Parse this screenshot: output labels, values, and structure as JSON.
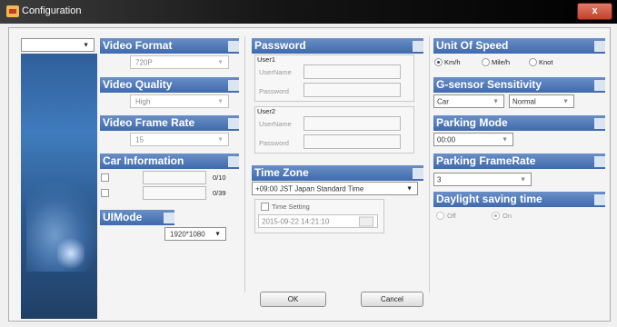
{
  "window": {
    "title": "Configuration",
    "close_glyph": "x"
  },
  "sidebar": {
    "dropdown_value": ""
  },
  "video_format": {
    "title": "Video Format",
    "value": "720P"
  },
  "video_quality": {
    "title": "Video Quality",
    "value": "High"
  },
  "video_frame_rate": {
    "title": "Video Frame Rate",
    "value": "15"
  },
  "car_information": {
    "title": "Car Information",
    "rows": [
      {
        "value": "",
        "counter": "0/10",
        "checked": false
      },
      {
        "value": "",
        "counter": "0/39",
        "checked": false
      }
    ]
  },
  "ui_mode": {
    "title": "UIMode",
    "value": "1920*1080"
  },
  "password": {
    "title": "Password",
    "users": [
      {
        "label": "User1",
        "username_label": "UserName",
        "password_label": "Password",
        "username": "",
        "password": ""
      },
      {
        "label": "User2",
        "username_label": "UserName",
        "password_label": "Password",
        "username": "",
        "password": ""
      }
    ]
  },
  "time_zone": {
    "title": "Time Zone",
    "value": "+09:00 JST Japan Standard Time",
    "time_setting_label": "Time Setting",
    "time_setting_checked": false,
    "datetime_value": "2015-09-22 14:21:10"
  },
  "unit_of_speed": {
    "title": "Unit Of Speed",
    "options": [
      {
        "label": "Km/h",
        "selected": true
      },
      {
        "label": "Mile/h",
        "selected": false
      },
      {
        "label": "Knot",
        "selected": false
      }
    ]
  },
  "g_sensor": {
    "title": "G-sensor Sensitivity",
    "mode_value": "Car",
    "level_value": "Normal"
  },
  "parking_mode": {
    "title": "Parking Mode",
    "value": "00:00"
  },
  "parking_frame_rate": {
    "title": "Parking FrameRate",
    "value": "3"
  },
  "daylight_saving": {
    "title": "Daylight saving time",
    "options": [
      {
        "label": "Off",
        "selected": false
      },
      {
        "label": "On",
        "selected": true
      }
    ]
  },
  "buttons": {
    "ok": "OK",
    "cancel": "Cancel"
  },
  "icons": {
    "dropdown_arrow": "▼",
    "app_icon": "configuration-app-icon",
    "calendar_icon": "calendar-icon"
  },
  "colors": {
    "header_blue": "#3f6aad",
    "titlebar": "#151515",
    "close_red": "#c4402b",
    "sidebar_blue": "#2f5f9a"
  }
}
